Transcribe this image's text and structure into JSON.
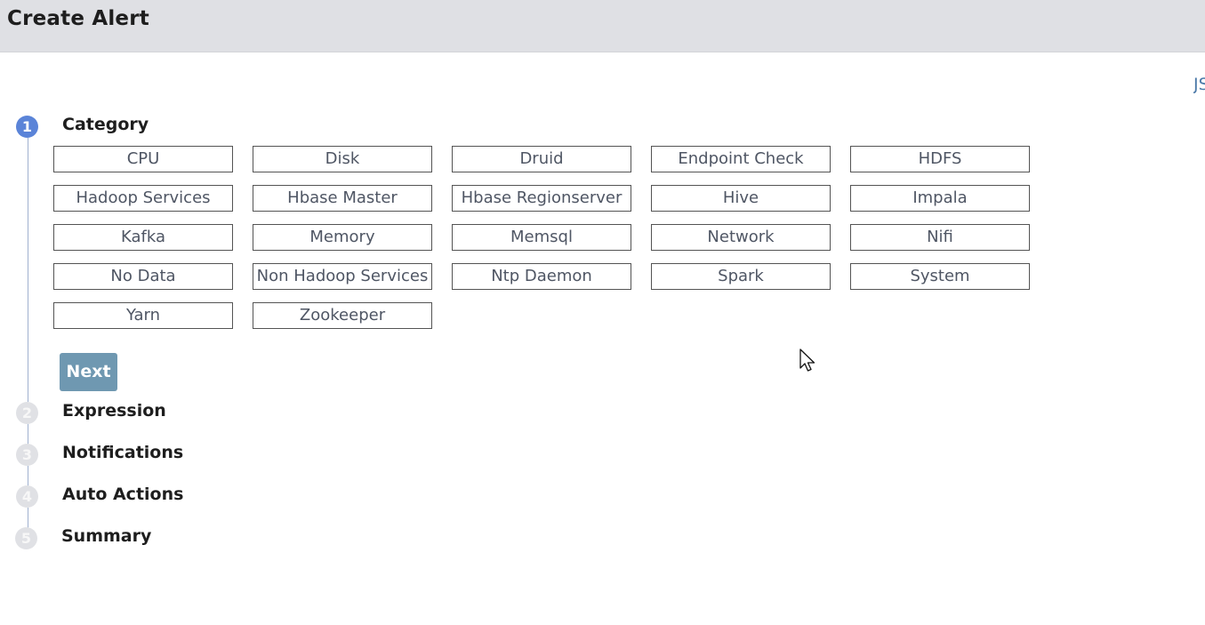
{
  "header": {
    "title": "Create Alert"
  },
  "json_link": {
    "label": "JSON"
  },
  "steps": [
    {
      "number": "1",
      "label": "Category",
      "active": true
    },
    {
      "number": "2",
      "label": "Expression",
      "active": false
    },
    {
      "number": "3",
      "label": "Notifications",
      "active": false
    },
    {
      "number": "4",
      "label": "Auto Actions",
      "active": false
    },
    {
      "number": "5",
      "label": "Summary",
      "active": false
    }
  ],
  "categories": [
    "CPU",
    "Disk",
    "Druid",
    "Endpoint Check",
    "HDFS",
    "Hadoop Services",
    "Hbase Master",
    "Hbase Regionserver",
    "Hive",
    "Impala",
    "Kafka",
    "Memory",
    "Memsql",
    "Network",
    "Nifi",
    "No Data",
    "Non Hadoop Services",
    "Ntp Daemon",
    "Spark",
    "System",
    "Yarn",
    "Zookeeper"
  ],
  "next_button": {
    "label": "Next"
  },
  "colors": {
    "header_bg": "#dfe0e4",
    "active_step": "#5b84d8",
    "inactive_step": "#e0e1e5",
    "next_button": "#6f98b1",
    "link": "#4b79a8"
  },
  "icons": {
    "cursor": "mouse-pointer-icon"
  }
}
